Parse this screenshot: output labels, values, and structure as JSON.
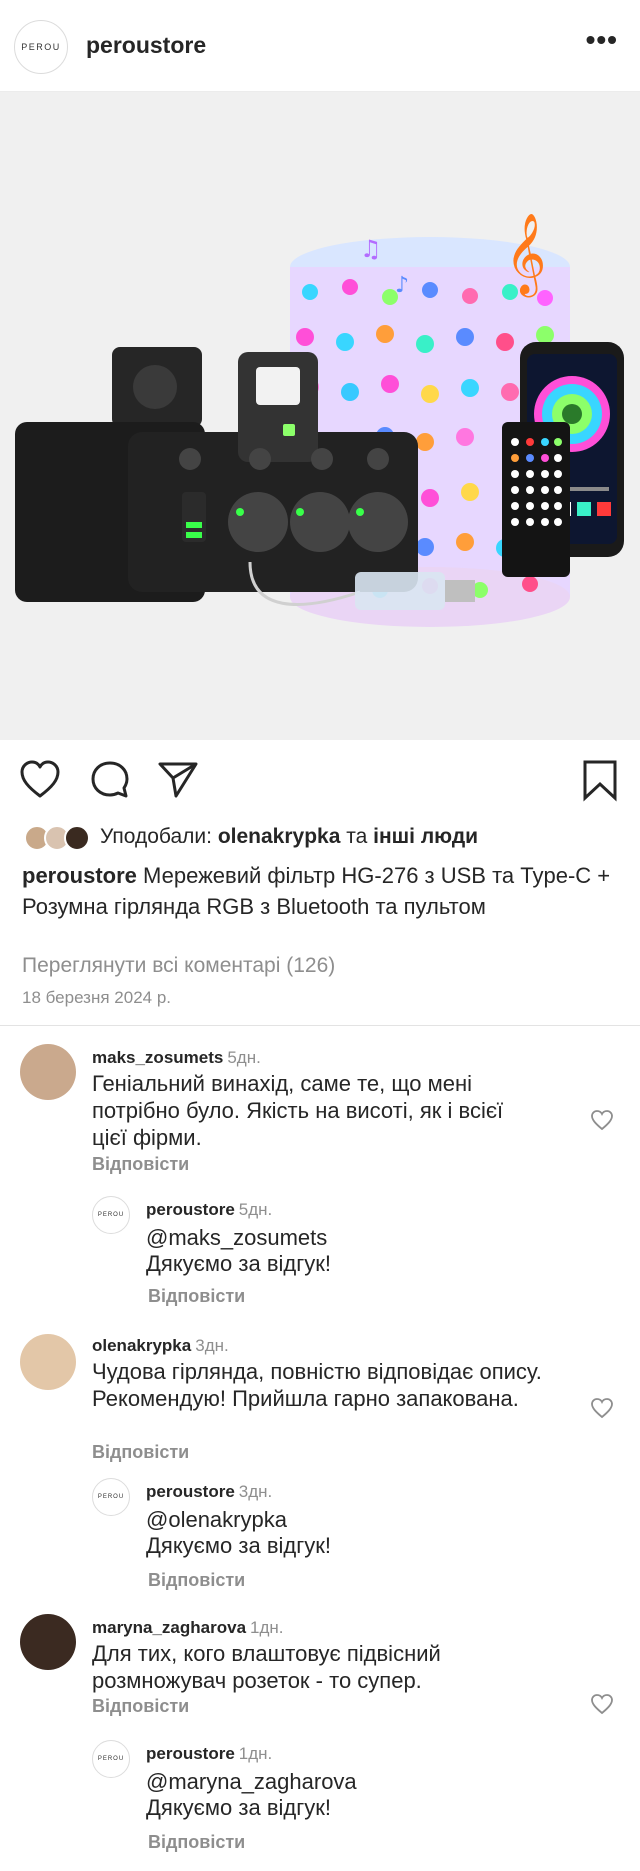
{
  "header": {
    "username": "peroustore",
    "avatar_text": "PEROU",
    "more_label": "•••"
  },
  "likes": {
    "prefix": "Уподобали:",
    "user": "olenakrypka",
    "and": "та",
    "others": "інші люди"
  },
  "caption": {
    "username": "peroustore",
    "text": "Мережевий фільтр HG-276 з USB та Type-C + Розумна гірлянда RGB з Bluetooth та пультом"
  },
  "view_all": "Переглянути всі коментарі (126)",
  "date": "18 березня 2024 р.",
  "comments": [
    {
      "user": "maks_zosumets",
      "time": "5дн.",
      "text": "Геніальний винахід, саме те, що мені потрібно було. Якість на висоті, як і всієї цієї фірми.",
      "reply": "Відповісти"
    },
    {
      "user": "olenakrypka",
      "time": "3дн.",
      "text": "Чудова гірлянда, повністю відповідає опису. Рекомендую! Прийшла гарно запакована.",
      "reply": "Відповісти"
    },
    {
      "user": "maryna_zagharova",
      "time": "1дн.",
      "text": "Для тих, кого влаштовує підвісний розмножувач розеток - то супер.",
      "reply": "Відповісти"
    }
  ],
  "replies": [
    {
      "user": "peroustore",
      "time": "5дн.",
      "mention": "@maks_zosumets",
      "text": "Дякуємо за відгук!",
      "reply": "Відповісти"
    },
    {
      "user": "peroustore",
      "time": "3дн.",
      "mention": "@olenakrypka",
      "text": "Дякуємо за відгук!",
      "reply": "Відповісти"
    },
    {
      "user": "peroustore",
      "time": "1дн.",
      "mention": "@maryna_zagharova",
      "text": "Дякуємо за відгук!",
      "reply": "Відповісти"
    }
  ],
  "colors": {
    "text": "#262626",
    "muted": "#8e8e8e",
    "mention": "#1f3a68",
    "divider": "#e3e3e3"
  }
}
